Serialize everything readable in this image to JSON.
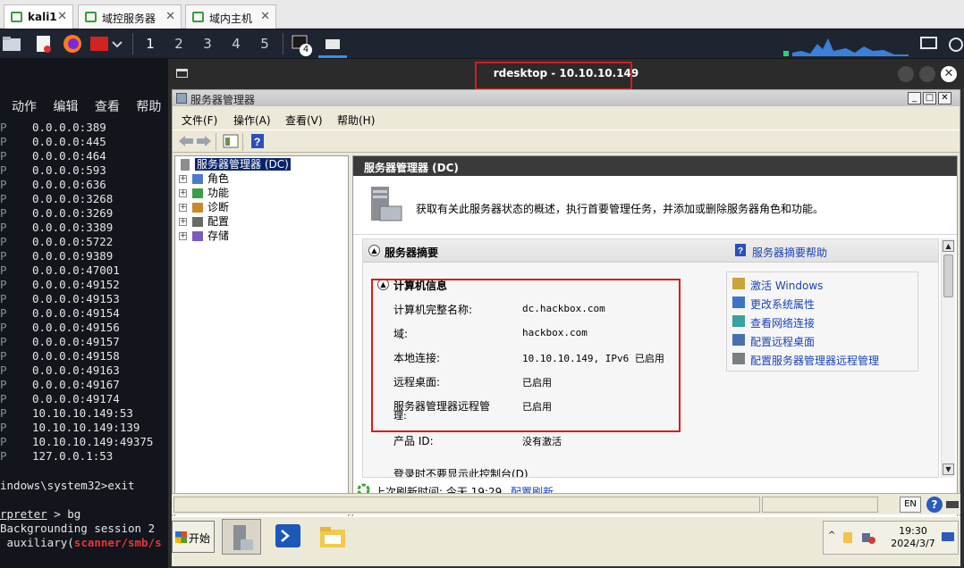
{
  "vm_tabs": [
    {
      "label": "kali1",
      "active": true
    },
    {
      "label": "域控服务器",
      "active": false
    },
    {
      "label": "域内主机",
      "active": false
    }
  ],
  "kali_panel": {
    "workspaces": [
      "1",
      "2",
      "3",
      "4",
      "5"
    ],
    "terminal_badge": "4"
  },
  "terminal": {
    "menu": [
      "动作",
      "编辑",
      "查看",
      "帮助"
    ],
    "addresses": [
      "0.0.0.0:389",
      "0.0.0.0:445",
      "0.0.0.0:464",
      "0.0.0.0:593",
      "0.0.0.0:636",
      "0.0.0.0:3268",
      "0.0.0.0:3269",
      "0.0.0.0:3389",
      "0.0.0.0:5722",
      "0.0.0.0:9389",
      "0.0.0.0:47001",
      "0.0.0.0:49152",
      "0.0.0.0:49153",
      "0.0.0.0:49154",
      "0.0.0.0:49156",
      "0.0.0.0:49157",
      "0.0.0.0:49158",
      "0.0.0.0:49163",
      "0.0.0.0:49167",
      "0.0.0.0:49174",
      "10.10.10.149:53",
      "10.10.10.149:139",
      "10.10.10.149:49375",
      "127.0.0.1:53"
    ],
    "exit_line": "indows\\system32>exit",
    "bg_prefix": "rpreter",
    "bg_cmd": " > bg",
    "bg_msg": "Backgrounding session 2",
    "aux_prefix": " auxiliary(",
    "aux_module": "scanner/smb/s"
  },
  "rdesktop": {
    "title": "rdesktop - 10.10.10.149"
  },
  "server_manager": {
    "window_title": "服务器管理器",
    "menu": [
      "文件(F)",
      "操作(A)",
      "查看(V)",
      "帮助(H)"
    ],
    "tree": {
      "root": "服务器管理器 (DC)",
      "children": [
        "角色",
        "功能",
        "诊断",
        "配置",
        "存储"
      ]
    },
    "pane_header": "服务器管理器 (DC)",
    "description": "获取有关此服务器状态的概述，执行首要管理任务，并添加或删除服务器角色和功能。",
    "summary": {
      "title": "服务器摘要",
      "help_link": "服务器摘要帮助",
      "computer_info_title": "计算机信息",
      "rows": [
        {
          "label": "计算机完整名称:",
          "value": "dc.hackbox.com"
        },
        {
          "label": "域:",
          "value": "hackbox.com"
        },
        {
          "label": "本地连接:",
          "value": "10.10.10.149, IPv6 已启用"
        },
        {
          "label": "远程桌面:",
          "value": "已启用"
        },
        {
          "label": "服务器管理器远程管",
          "label2": "理:",
          "value": "已启用"
        },
        {
          "label": "产品 ID:",
          "value": "没有激活"
        }
      ],
      "cut_off": "登录时不要显示此控制台(D)",
      "tasks": [
        "激活 Windows",
        "更改系统属性",
        "查看网络连接",
        "配置远程桌面",
        "配置服务器管理器远程管理"
      ]
    },
    "footer": {
      "last_refresh": "上次刷新时间: 今天 19:29",
      "refresh_link": "配置刷新"
    },
    "status": {
      "lang": "EN"
    }
  },
  "taskbar": {
    "start": "开始",
    "clock_time": "19:30",
    "clock_date": "2024/3/7"
  }
}
